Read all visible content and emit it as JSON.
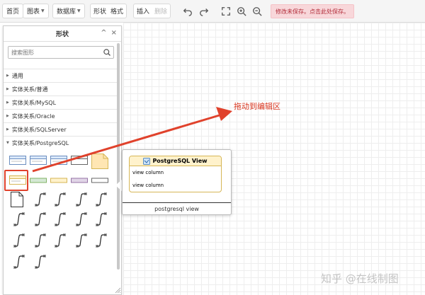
{
  "toolbar": {
    "home": "首页",
    "chart": "图表",
    "database": "数据库",
    "shape": "形状",
    "format": "格式",
    "insert": "插入",
    "delete": "删除",
    "unsaved_notice": "修改未保存。点击此处保存。"
  },
  "sidebar": {
    "title": "形状",
    "search_placeholder": "搜索图形",
    "categories": [
      "通用",
      "实体关系/普通",
      "实体关系/MySQL",
      "实体关系/Oracle",
      "实体关系/SQLServer",
      "实体关系/PostgreSQL"
    ]
  },
  "popup": {
    "table_title": "PostgreSQL View",
    "rows": [
      "view column",
      "view column"
    ],
    "caption": "postgresql view"
  },
  "annotation": {
    "drag_hint": "拖动到编辑区",
    "color": "#e0422c"
  },
  "watermark": "知乎 @在线制图"
}
